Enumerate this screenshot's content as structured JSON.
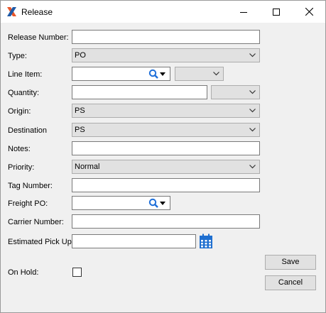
{
  "window": {
    "title": "Release",
    "icon": "x-logo-icon",
    "controls": [
      "minimize-icon",
      "maximize-icon",
      "close-icon"
    ]
  },
  "form": {
    "release_number": {
      "label": "Release Number:",
      "value": ""
    },
    "type": {
      "label": "Type:",
      "value": "PO"
    },
    "line_item": {
      "label": "Line Item:",
      "value": "",
      "secondary_value": ""
    },
    "quantity": {
      "label": "Quantity:",
      "value": "",
      "unit_value": ""
    },
    "origin": {
      "label": "Origin:",
      "value": "PS"
    },
    "destination": {
      "label": "Destination",
      "value": "PS"
    },
    "notes": {
      "label": "Notes:",
      "value": ""
    },
    "priority": {
      "label": "Priority:",
      "value": "Normal"
    },
    "tag_number": {
      "label": "Tag Number:",
      "value": ""
    },
    "freight_po": {
      "label": "Freight PO:",
      "value": ""
    },
    "carrier_number": {
      "label": "Carrier Number:",
      "value": ""
    },
    "estimated_pick_up": {
      "label": "Estimated Pick Up",
      "value": ""
    },
    "on_hold": {
      "label": "On Hold:",
      "checked": false
    }
  },
  "buttons": {
    "save": "Save",
    "cancel": "Cancel"
  },
  "colors": {
    "logo_orange": "#e8572a",
    "logo_blue": "#1f5aa6",
    "lookup_blue": "#1e6fd9",
    "calendar_blue": "#1f6fd0"
  }
}
